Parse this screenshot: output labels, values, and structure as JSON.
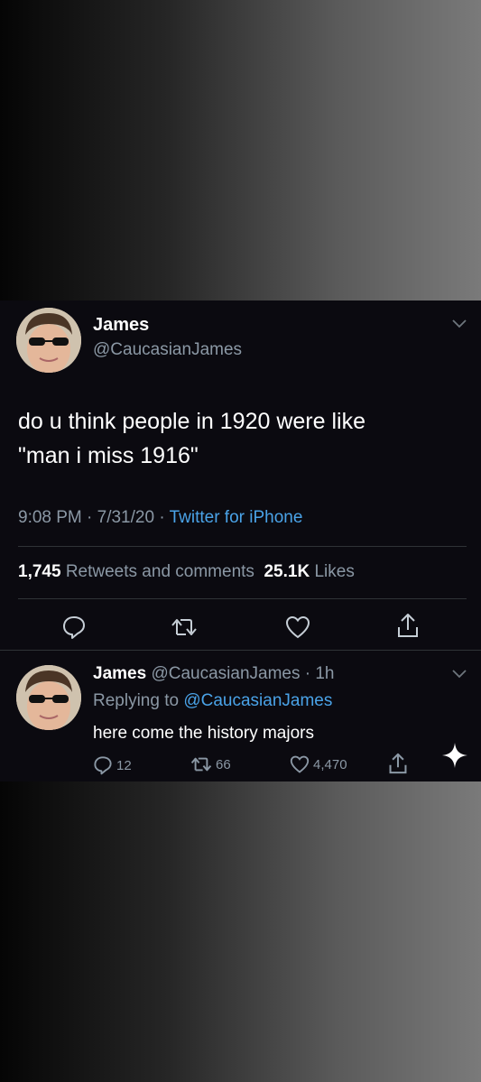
{
  "tweet": {
    "name": "James",
    "handle": "@CaucasianJames",
    "text_line1": "do u think people in 1920 were like",
    "text_line2": "\"man i miss 1916\"",
    "time": "9:08 PM · 7/31/20 · ",
    "source": "Twitter for iPhone",
    "retweets_count": "1,745",
    "retweets_label": "Retweets and comments",
    "likes_count": "25.1K",
    "likes_label": "Likes"
  },
  "reply": {
    "name": "James",
    "handle_time": "@CaucasianJames · 1h",
    "replying_prefix": "Replying to",
    "replying_to": "@CaucasianJames",
    "text": "here come the history majors",
    "comments": "12",
    "retweets": "66",
    "likes": "4,470"
  },
  "icons": {
    "comment": "comment-icon",
    "retweet": "retweet-icon",
    "like": "heart-icon",
    "share": "share-icon",
    "more": "chevron-down-icon",
    "compose": "sparkle-icon"
  }
}
